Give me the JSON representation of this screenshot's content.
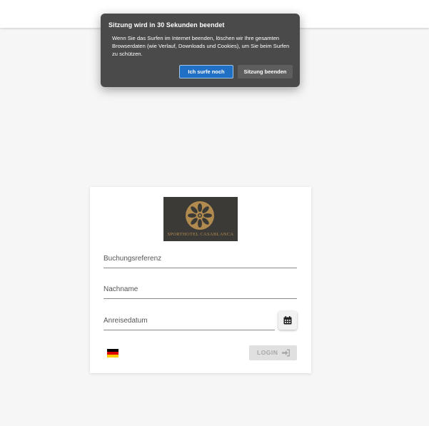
{
  "dialog": {
    "title": "Sitzung wird in 30 Sekunden beendet",
    "message": "Wenn Sie das Surfen im Internet beenden, löschen wir Ihre gesamten Browserdaten (wie Verlauf, Downloads und Cookies), um Sie beim Surfen zu schützen.",
    "continue_label": "Ich surfe noch",
    "end_label": "Sitzung beenden",
    "continue_color": "#1f6fc4"
  },
  "logo": {
    "text": "SPORTHOTEL CASABLANCA",
    "background": "#3c3a36",
    "emblem_color": "#b08a4e"
  },
  "form": {
    "booking_ref_label": "Buchungsreferenz",
    "lastname_label": "Nachname",
    "arrival_label": "Anreisedatum",
    "calendar_icon": "calendar-icon",
    "language_flag": "german-flag-icon",
    "login_label": "LOGIN",
    "login_icon": "sign-in-icon"
  }
}
